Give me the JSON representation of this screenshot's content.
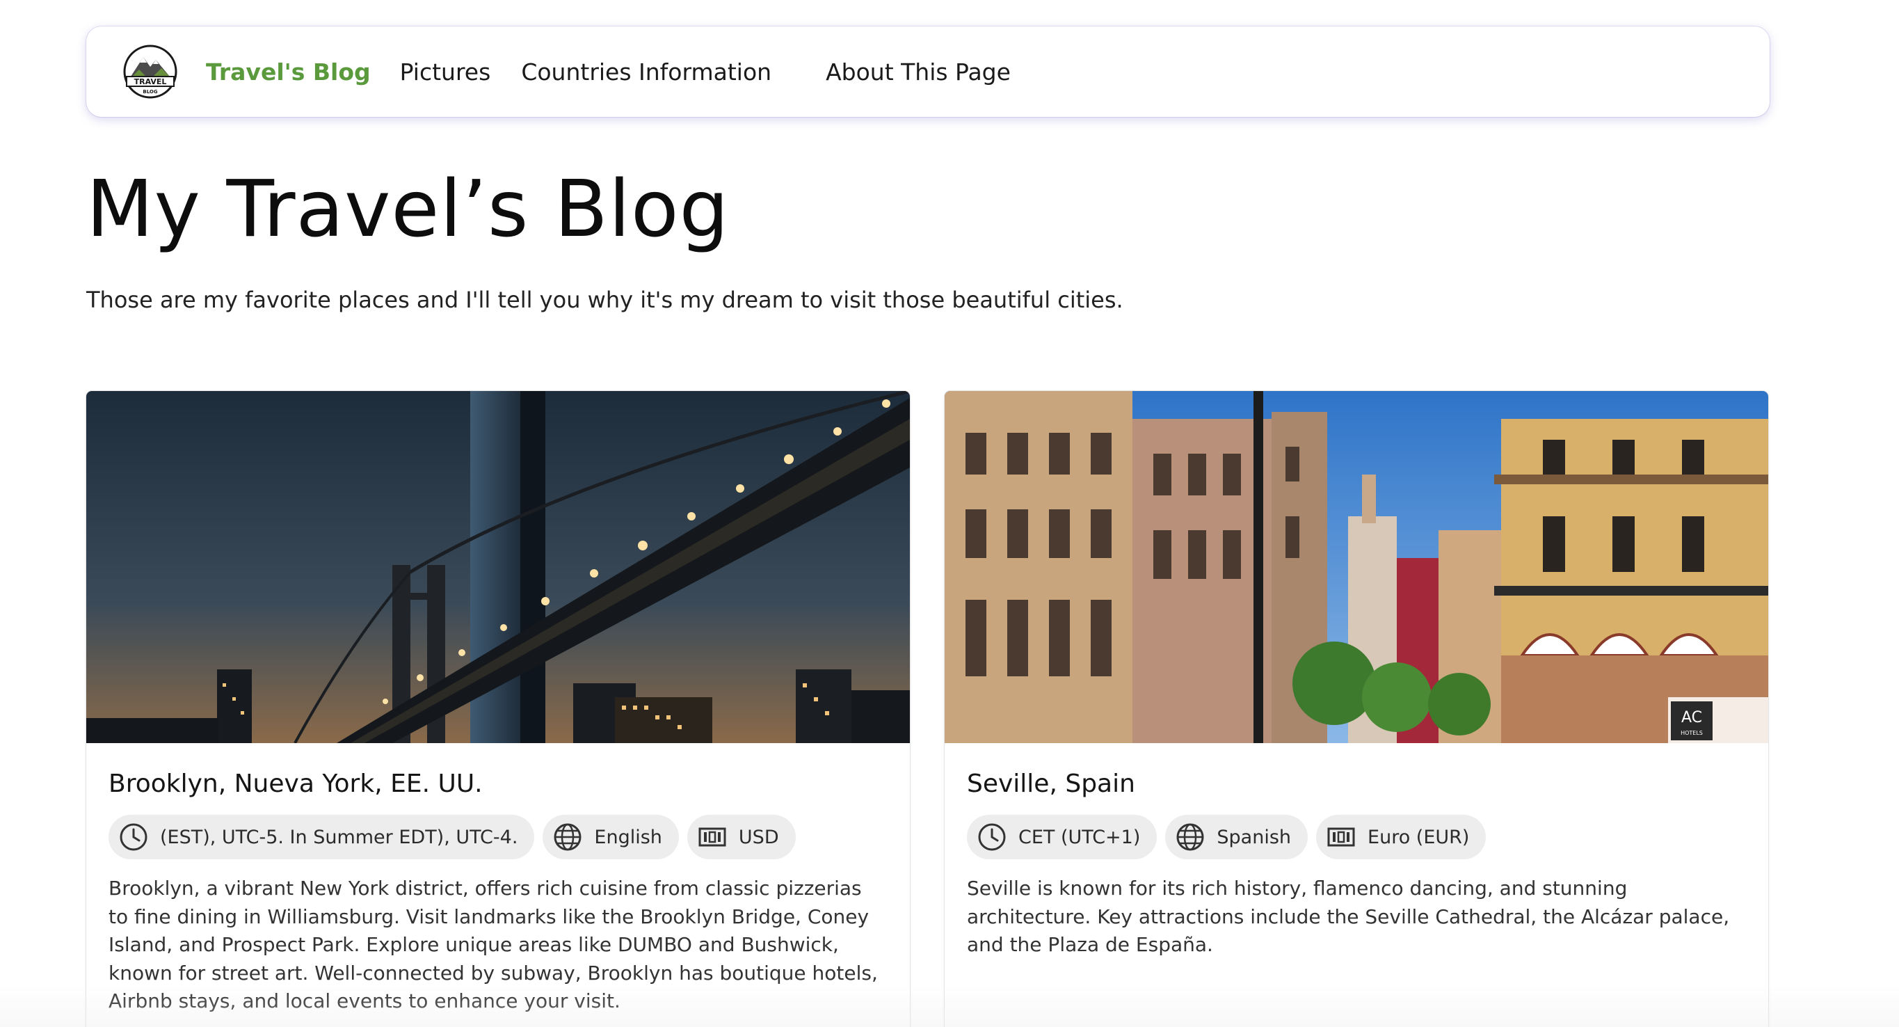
{
  "nav": {
    "brand_label": "Travel's Blog",
    "links": [
      {
        "label": "Pictures"
      },
      {
        "label": "Countries Information"
      },
      {
        "label": "About This Page"
      }
    ],
    "logo_text": "TRAVEL",
    "logo_subtext": "BLOG"
  },
  "hero": {
    "title": "My Travel’s Blog",
    "subtitle": "Those are my favorite places and I'll tell you why it's my dream to visit those beautiful cities."
  },
  "cards": [
    {
      "title": "Brooklyn, Nueva York, EE. UU.",
      "timezone": "(EST), UTC-5. In Summer EDT), UTC-4.",
      "language": "English",
      "currency": "USD",
      "description": "Brooklyn, a vibrant New York district, offers rich cuisine from classic pizzerias to fine dining in Williamsburg. Visit landmarks like the Brooklyn Bridge, Coney Island, and Prospect Park. Explore unique areas like DUMBO and Bushwick, known for street art. Well-connected by subway, Brooklyn has boutique hotels, Airbnb stays, and local events to enhance your visit."
    },
    {
      "title": "Seville, Spain",
      "timezone": "CET (UTC+1)",
      "language": "Spanish",
      "currency": "Euro (EUR)",
      "description": "Seville is known for its rich history, flamenco dancing, and stunning architecture. Key attractions include the Seville Cathedral, the Alcázar palace, and the Plaza de España.",
      "image_sign_text": "AC",
      "image_sign_subtext": "HOTELS"
    }
  ],
  "colors": {
    "accent": "#5a9a3c",
    "chip_bg": "#ededed"
  },
  "icons": {
    "timezone": "clock-icon",
    "language": "globe-icon",
    "currency": "banknote-icon"
  }
}
